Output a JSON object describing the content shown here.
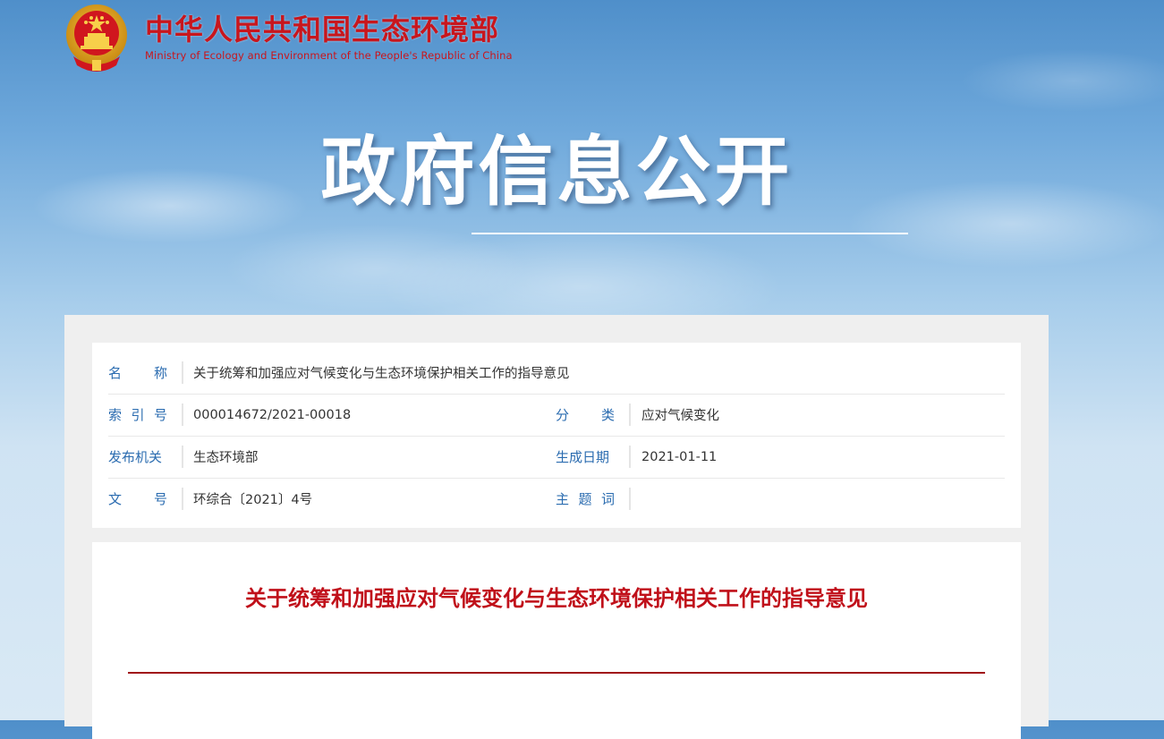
{
  "header": {
    "name_cn": "中华人民共和国生态环境部",
    "name_en": "Ministry of Ecology and Environment of the People's Republic of China"
  },
  "hero": {
    "title": "政府信息公开"
  },
  "meta": {
    "name_label": "名称",
    "name_value": "关于统筹和加强应对气候变化与生态环境保护相关工作的指导意见",
    "index_label": "索引号",
    "index_value": "000014672/2021-00018",
    "category_label": "分类",
    "category_value": "应对气候变化",
    "issuer_label": "发布机关",
    "issuer_value": "生态环境部",
    "date_label": "生成日期",
    "date_value": "2021-01-11",
    "doc_no_label": "文号",
    "doc_no_value": "环综合〔2021〕4号",
    "keywords_label": "主题词",
    "keywords_value": ""
  },
  "document": {
    "title": "关于统筹和加强应对气候变化与生态环境保护相关工作的指导意见"
  },
  "colors": {
    "brand_red": "#c8161d",
    "label_blue": "#2b6cb0",
    "title_red": "#c0101a"
  }
}
